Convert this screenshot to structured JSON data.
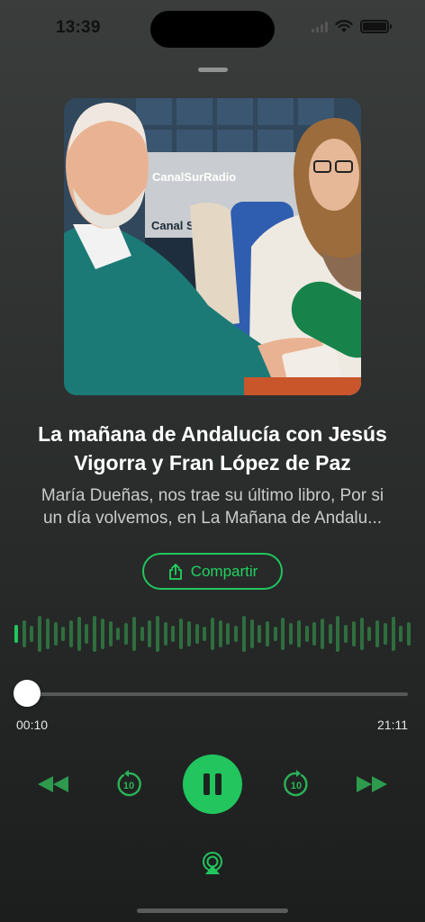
{
  "status_bar": {
    "time": "13:39",
    "icons": [
      "cellular-signal-icon",
      "wifi-icon",
      "battery-icon"
    ]
  },
  "episode": {
    "title": "La mañana de Andalucía con Jesús Vigorra y Fran López de Paz",
    "title_lines": [
      "La mañana de Andalucía con Jesús",
      "Vigorra y Fran López de Paz"
    ],
    "description_lines": [
      "María Dueñas, nos trae su último libro, Por si",
      "un día volvemos, en La Mañana de Andalu..."
    ],
    "artwork_texts": [
      "CanalSurRadio",
      "Canal Sur"
    ]
  },
  "share": {
    "label": "Compartir",
    "icon": "share-icon"
  },
  "player": {
    "elapsed": "00:10",
    "total": "21:11",
    "progress_fraction": 0.008,
    "state": "playing",
    "skip_back_seconds": "10",
    "skip_forward_seconds": "10"
  },
  "colors": {
    "accent": "#22c55e",
    "waveform_unplayed": "#2f6e3f",
    "background_top": "#3a3d3c",
    "background_bottom": "#1c1e1e"
  }
}
